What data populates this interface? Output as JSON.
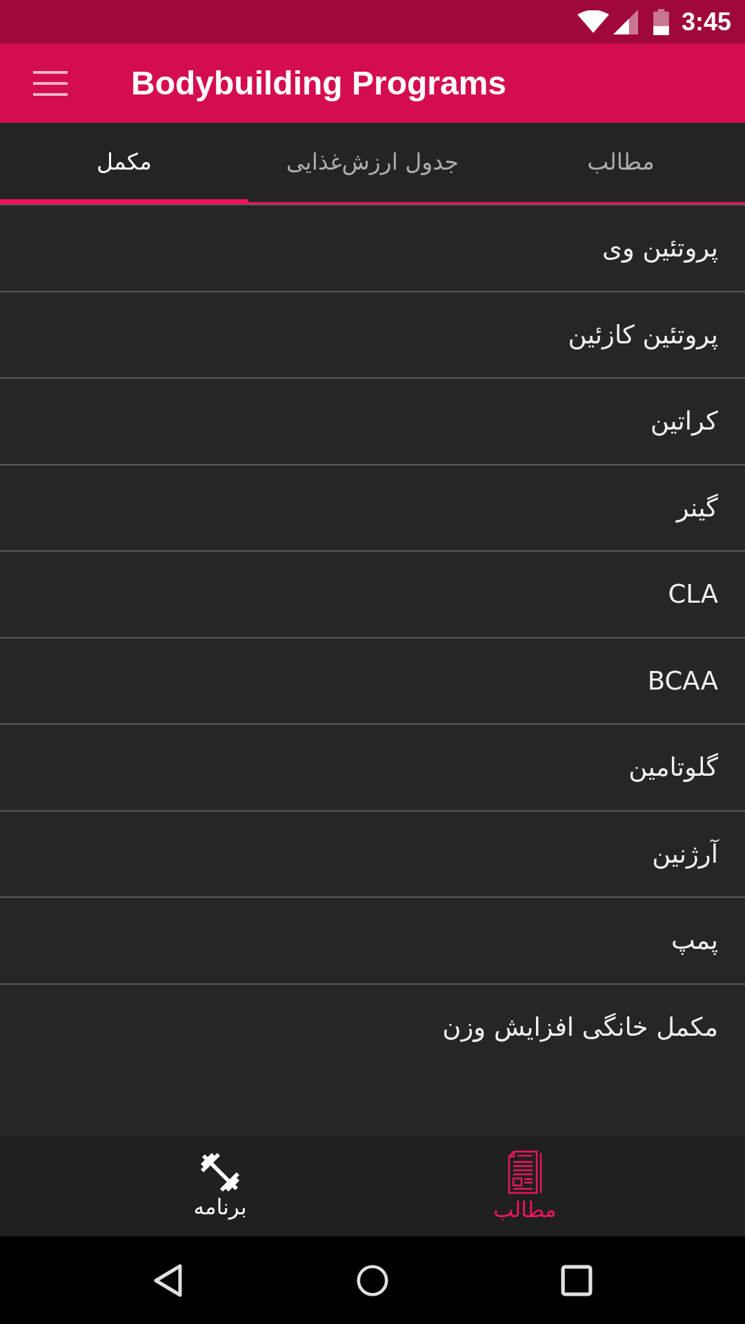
{
  "status_bar": {
    "time": "3:45"
  },
  "app_bar": {
    "title": "Bodybuilding Programs"
  },
  "tabs": [
    {
      "label": "مطالب",
      "selected": false
    },
    {
      "label": "جدول ارزش‌غذایی",
      "selected": false
    },
    {
      "label": "مکمل",
      "selected": true
    }
  ],
  "list": {
    "items": [
      "پروتئین وی",
      "پروتئین کازئین",
      "کراتین",
      "گینر",
      "CLA",
      "BCAA",
      "گلوتامین",
      "آرژنین",
      "پمپ",
      "مکمل خانگی افزایش وزن"
    ]
  },
  "bottom_nav": [
    {
      "label": "مطالب",
      "kind": "document",
      "selected": true
    },
    {
      "label": "برنامه",
      "kind": "dumbbell",
      "selected": false
    }
  ]
}
